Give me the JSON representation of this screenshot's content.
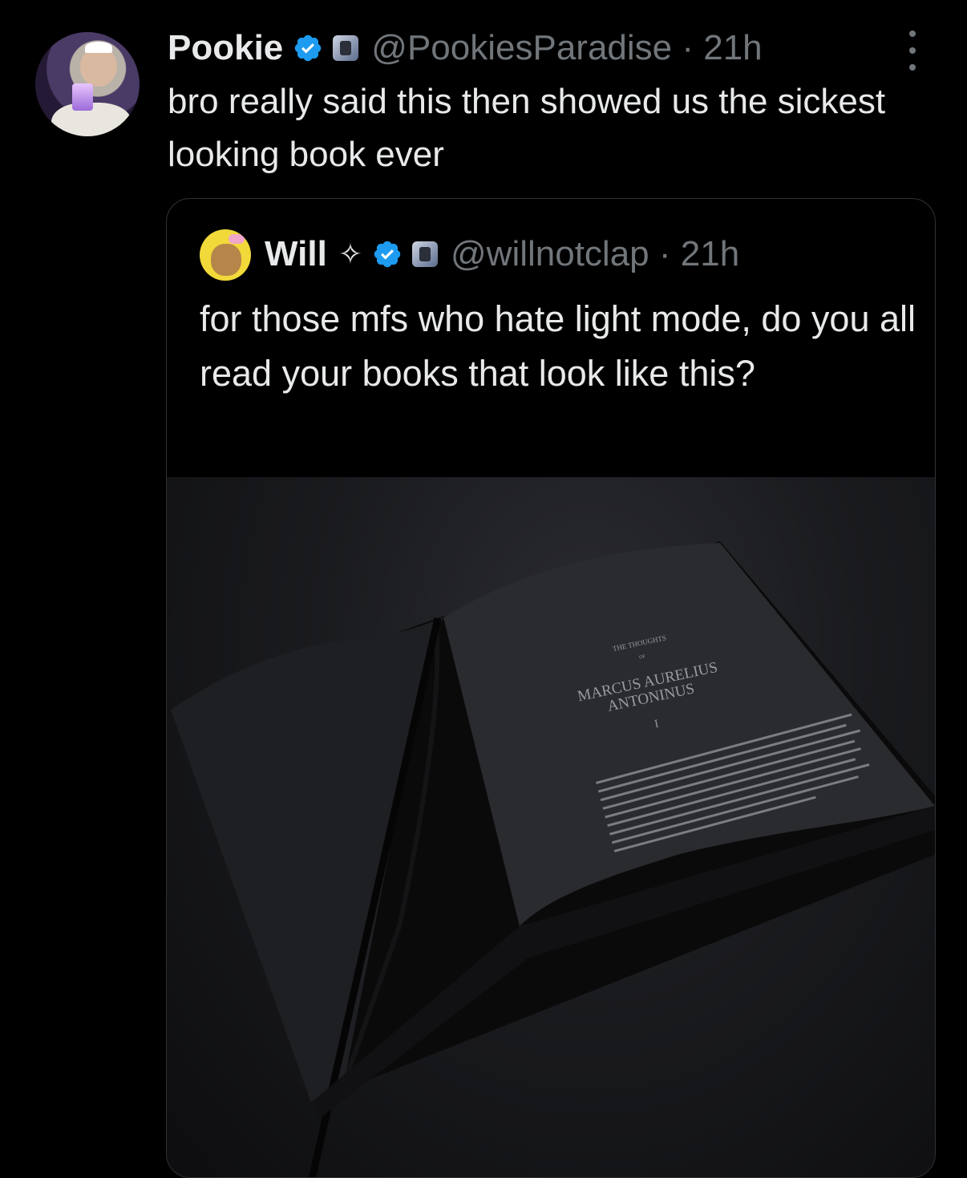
{
  "tweet": {
    "author_name": "Pookie",
    "handle_time": "@PookiesParadise · 21h",
    "text": "bro really said this then showed us the sickest looking book ever"
  },
  "quoted_tweet": {
    "author_name": "Will",
    "handle_time": "@willnotclap · 21h",
    "text": "for those mfs who hate light mode, do you all read your books that look like this?"
  },
  "book_page": {
    "small_title": "THE THOUGHTS",
    "of": "OF",
    "title_line1": "MARCUS AURELIUS",
    "title_line2": "ANTONINUS",
    "chapter": "I"
  },
  "colors": {
    "background": "#000000",
    "text": "#e7e9ea",
    "muted": "#71767b",
    "verified_blue": "#1d9bf0",
    "border": "#2f3336"
  }
}
